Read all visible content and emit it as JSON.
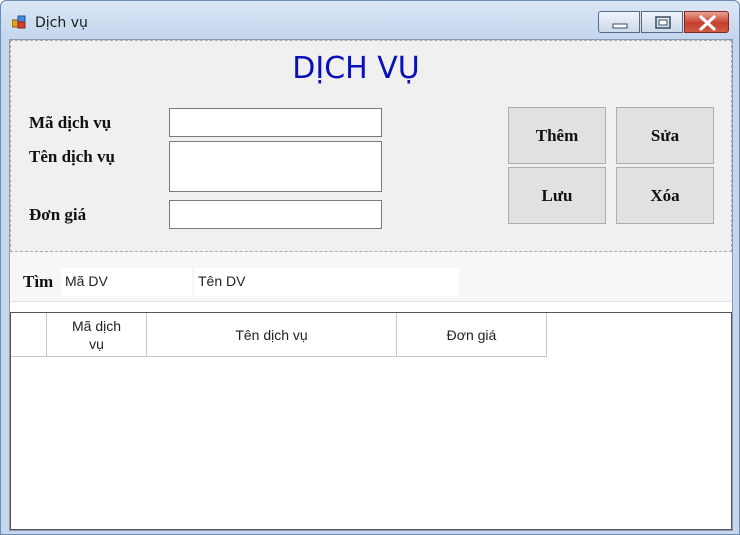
{
  "window": {
    "title": "Dịch vụ",
    "icon": "app-window-icon"
  },
  "controls": {
    "minimize": "minimize-icon",
    "maximize": "maximize-icon",
    "close": "close-icon"
  },
  "form": {
    "heading": "DỊCH VỤ",
    "labels": {
      "code": "Mã dịch vụ",
      "name": "Tên dịch vụ",
      "price": "Đơn giá"
    },
    "values": {
      "code": "",
      "name": "",
      "price": ""
    }
  },
  "buttons": {
    "add": "Thêm",
    "edit": "Sửa",
    "save": "Lưu",
    "delete": "Xóa"
  },
  "search": {
    "label": "Tìm",
    "code_field": "Mã DV",
    "name_field": "Tên DV"
  },
  "table": {
    "columns": [
      "Mã dịch vụ",
      "Tên dịch vụ",
      "Đơn giá"
    ],
    "rows": []
  },
  "colors": {
    "heading": "#0a10b8",
    "panel": "#f0f0f0",
    "button": "#e1e1e1"
  }
}
